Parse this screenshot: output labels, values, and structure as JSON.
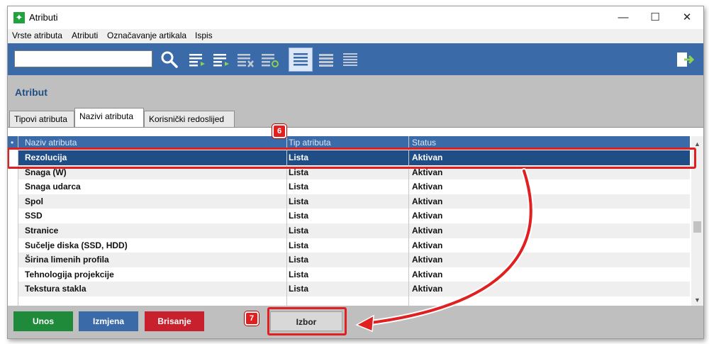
{
  "window": {
    "title": "Atributi"
  },
  "menu": [
    "Vrste atributa",
    "Atributi",
    "Označavanje artikala",
    "Ispis"
  ],
  "search": {
    "value": "",
    "placeholder": ""
  },
  "page_title": "Atribut",
  "tabs": [
    {
      "label": "Tipovi atributa"
    },
    {
      "label": "Nazivi atributa",
      "active": true
    },
    {
      "label": "Korisnički redoslijed"
    }
  ],
  "grid": {
    "columns": [
      "Naziv atributa",
      "Tip atributa",
      "Status"
    ],
    "rows": [
      {
        "name": "Rezolucija",
        "type": "Lista",
        "status": "Aktivan",
        "selected": true
      },
      {
        "name": "Snaga (W)",
        "type": "Lista",
        "status": "Aktivan"
      },
      {
        "name": "Snaga udarca",
        "type": "Lista",
        "status": "Aktivan"
      },
      {
        "name": "Spol",
        "type": "Lista",
        "status": "Aktivan"
      },
      {
        "name": "SSD",
        "type": "Lista",
        "status": "Aktivan"
      },
      {
        "name": "Stranice",
        "type": "Lista",
        "status": "Aktivan"
      },
      {
        "name": "Sučelje diska (SSD, HDD)",
        "type": "Lista",
        "status": "Aktivan"
      },
      {
        "name": "Širina limenih profila",
        "type": "Lista",
        "status": "Aktivan"
      },
      {
        "name": "Tehnologija projekcije",
        "type": "Lista",
        "status": "Aktivan"
      },
      {
        "name": "Tekstura stakla",
        "type": "Lista",
        "status": "Aktivan"
      }
    ]
  },
  "buttons": {
    "unos": "Unos",
    "izmjena": "Izmjena",
    "brisanje": "Brisanje",
    "izbor": "Izbor"
  },
  "annotations": {
    "step6": "6",
    "step7": "7"
  },
  "colors": {
    "toolbar": "#3a6aa8",
    "selected_row": "#1f4d85",
    "unos_btn": "#1f8a3a",
    "izmjena_btn": "#3a6aa8",
    "brisanje_btn": "#c8202c",
    "callout_red": "#e02020"
  }
}
